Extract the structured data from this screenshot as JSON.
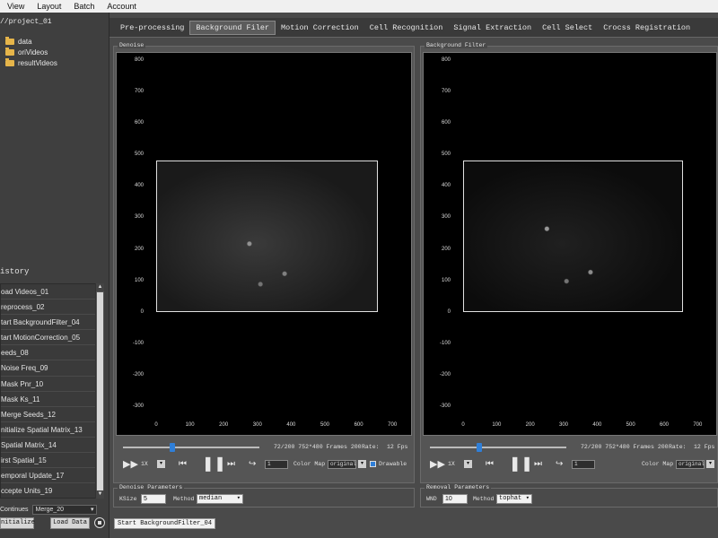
{
  "menu": [
    "View",
    "Layout",
    "Batch",
    "Account"
  ],
  "project": {
    "title": "//project_01",
    "folders": [
      "data",
      "oriVideos",
      "resultVideos"
    ]
  },
  "history": {
    "title": "istory",
    "items": [
      "oad Videos_01",
      "reprocess_02",
      "tart BackgroundFilter_04",
      "tart MotionCorrection_05",
      "eeds_08",
      "Noise Freq_09",
      "Mask Pnr_10",
      "Mask Ks_11",
      "Merge Seeds_12",
      "nitialize Spatial Matrix_13",
      "Spatial Matrix_14",
      "irst Spatial_15",
      "emporal Update_17",
      "ccepte Units_19"
    ]
  },
  "continues": {
    "label": "Continues",
    "value": "Merge_20"
  },
  "buttons": {
    "initialize": "nitialize",
    "load_data": "Load Data"
  },
  "tabs": [
    "Pre-processing",
    "Background Filer",
    "Motion Correction",
    "Cell Recognition",
    "Signal Extraction",
    "Cell Select",
    "Crocss Registration"
  ],
  "active_tab": 1,
  "yticks": [
    "800",
    "700",
    "600",
    "500",
    "400",
    "300",
    "200",
    "100",
    "0",
    "-100",
    "-200",
    "-300"
  ],
  "xticks": [
    "0",
    "100",
    "200",
    "300",
    "400",
    "500",
    "600",
    "700"
  ],
  "denoise": {
    "title": "Denoise",
    "frame_info": "72/200  752*480 Frames 200",
    "rate_label": "Rate:",
    "rate_value": "12 Fps",
    "speed": "1X",
    "step": "1",
    "colormap_label": "Color Map",
    "colormap_value": "original",
    "drawable": "Drawable",
    "slider_progress": 0.36
  },
  "bgfilter": {
    "title": "Background Filter",
    "frame_info": "72/200  752*480 Frames 200",
    "rate_label": "Rate:",
    "rate_value": "12 Fps",
    "speed": "1X",
    "step": "1",
    "colormap_label": "Color Map",
    "colormap_value": "original",
    "slider_progress": 0.36
  },
  "denoise_params": {
    "title": "Denoise Parameters",
    "ksize_label": "KSize",
    "ksize_value": "5",
    "method_label": "Method",
    "method_value": "median"
  },
  "removal_params": {
    "title": "Removal Parameters",
    "wnd_label": "WND",
    "wnd_value": "10",
    "method_label": "Method",
    "method_value": "tophat"
  },
  "status": "Start BackgroundFilter_04"
}
